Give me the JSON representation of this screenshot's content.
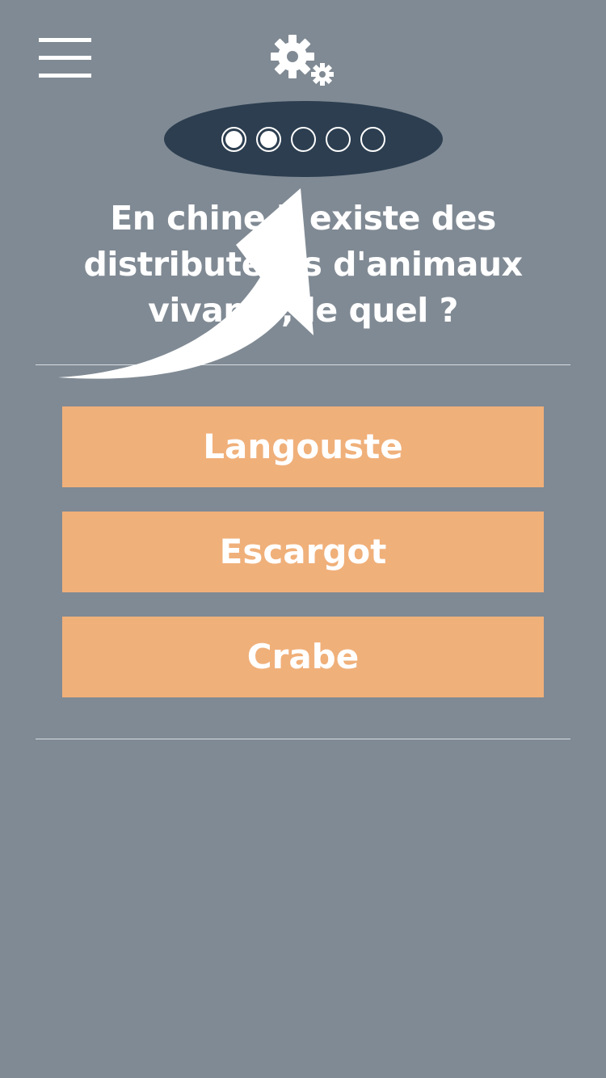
{
  "header": {
    "menu_icon": "hamburger-icon",
    "settings_icon": "gears-icon"
  },
  "progress": {
    "current": 2,
    "total": 5,
    "pill_color": "#2c3e50"
  },
  "question": {
    "text": "En chine il existe des distributeurs d'animaux vivants, le quel ?"
  },
  "answers": [
    {
      "label": "Langouste"
    },
    {
      "label": "Escargot"
    },
    {
      "label": "Crabe"
    }
  ],
  "colors": {
    "background": "#808a94",
    "answer_button": "#f0b07a",
    "text": "#ffffff"
  },
  "overlay": {
    "icon": "curved-arrow-icon"
  }
}
